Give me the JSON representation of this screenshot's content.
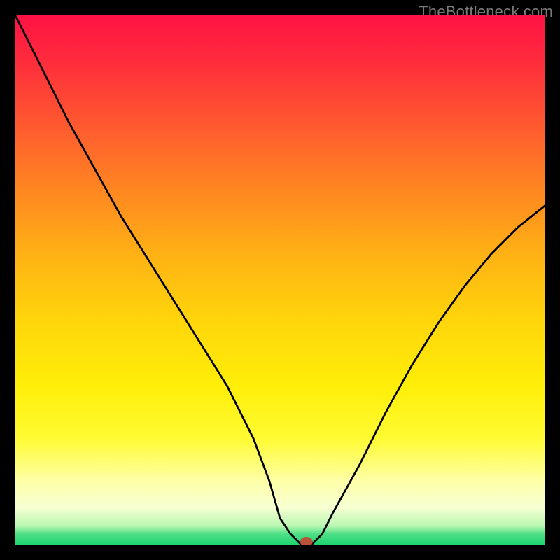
{
  "watermark": "TheBottleneck.com",
  "chart_data": {
    "type": "line",
    "title": "",
    "xlabel": "",
    "ylabel": "",
    "x": [
      0,
      5,
      10,
      15,
      20,
      25,
      30,
      35,
      40,
      45,
      48,
      50,
      52,
      54,
      56,
      58,
      60,
      65,
      70,
      75,
      80,
      85,
      90,
      95,
      100
    ],
    "values": [
      100,
      90,
      80,
      71,
      62,
      54,
      46,
      38,
      30,
      20,
      12,
      5,
      2,
      0,
      0,
      2,
      6,
      15,
      25,
      34,
      42,
      49,
      55,
      60,
      64
    ],
    "ylim": [
      0,
      100
    ],
    "xlim": [
      0,
      100
    ],
    "marker": {
      "x": 55,
      "y": 0
    },
    "annotations": [],
    "legend": []
  }
}
